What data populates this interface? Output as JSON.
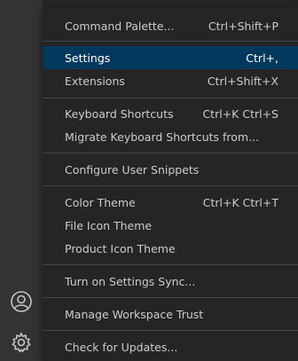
{
  "colors": {
    "activitybar_bg": "#333333",
    "menu_bg": "#252526",
    "menu_text": "#cccccc",
    "selected_bg": "#04395e",
    "selected_text": "#ffffff",
    "separator": "#454545"
  },
  "activitybar": {
    "accounts_icon": "account-icon",
    "manage_icon": "gear-icon"
  },
  "menu": {
    "items": [
      {
        "label": "Command Palette...",
        "shortcut": "Ctrl+Shift+P"
      },
      {
        "label": "Settings",
        "shortcut": "Ctrl+,"
      },
      {
        "label": "Extensions",
        "shortcut": "Ctrl+Shift+X"
      },
      {
        "label": "Keyboard Shortcuts",
        "shortcut": "Ctrl+K Ctrl+S"
      },
      {
        "label": "Migrate Keyboard Shortcuts from...",
        "shortcut": ""
      },
      {
        "label": "Configure User Snippets",
        "shortcut": ""
      },
      {
        "label": "Color Theme",
        "shortcut": "Ctrl+K Ctrl+T"
      },
      {
        "label": "File Icon Theme",
        "shortcut": ""
      },
      {
        "label": "Product Icon Theme",
        "shortcut": ""
      },
      {
        "label": "Turn on Settings Sync...",
        "shortcut": ""
      },
      {
        "label": "Manage Workspace Trust",
        "shortcut": ""
      },
      {
        "label": "Check for Updates...",
        "shortcut": ""
      }
    ]
  }
}
